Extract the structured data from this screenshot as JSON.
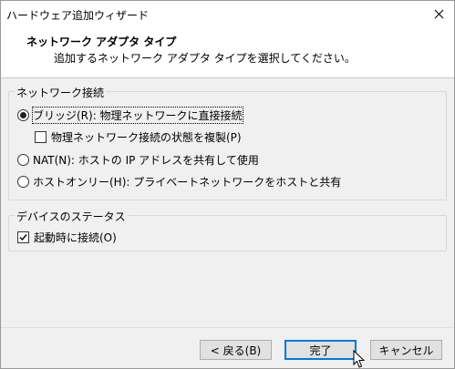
{
  "window": {
    "title": "ハードウェア追加ウィザード"
  },
  "header": {
    "title": "ネットワーク アダプタ タイプ",
    "subtitle": "追加するネットワーク アダプタ タイプを選択してください。"
  },
  "network_group": {
    "label": "ネットワーク接続",
    "options": [
      {
        "label": "ブリッジ(R): 物理ネットワークに直接接続",
        "checked": true
      },
      {
        "label": "NAT(N): ホストの IP アドレスを共有して使用",
        "checked": false
      },
      {
        "label": "ホストオンリー(H): プライベートネットワークをホストと共有",
        "checked": false
      }
    ],
    "replicate_label": "物理ネットワーク接続の状態を複製(P)",
    "replicate_checked": false
  },
  "device_group": {
    "label": "デバイスのステータス",
    "connect_on_start_label": "起動時に接続(O)",
    "connect_on_start_checked": true
  },
  "buttons": {
    "back": "< 戻る(B)",
    "finish": "完了",
    "cancel": "キャンセル"
  }
}
